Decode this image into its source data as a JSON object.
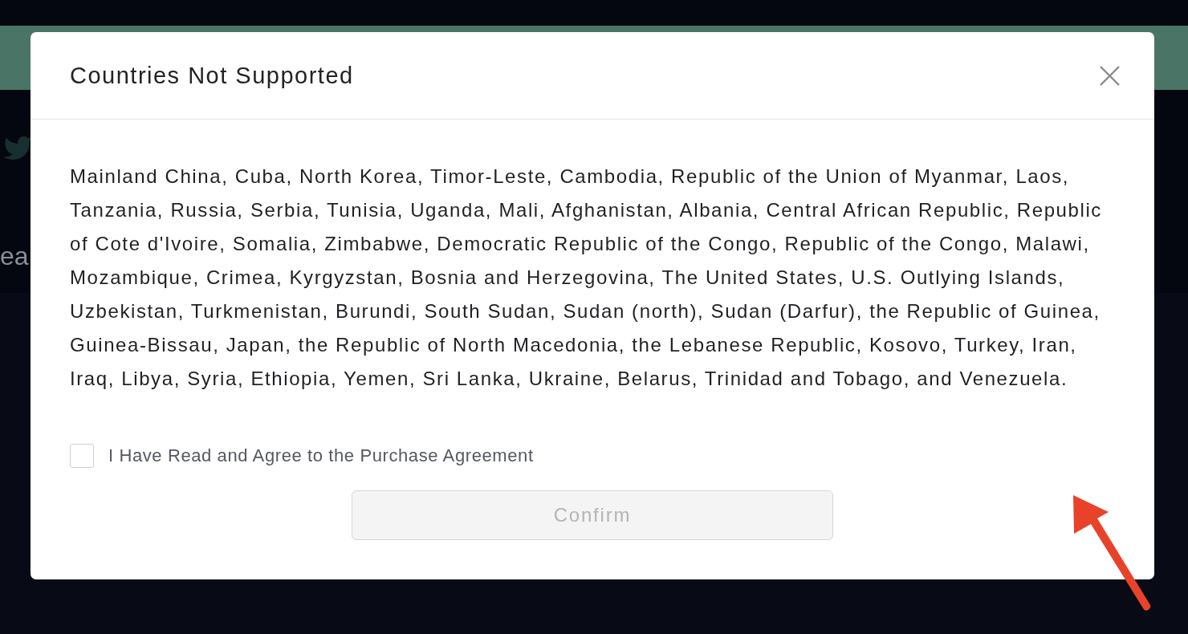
{
  "background": {
    "side_text": "ea"
  },
  "dialog": {
    "title": "Countries Not Supported",
    "message": "Mainland China, Cuba, North Korea, Timor-Leste, Cambodia, Republic of the Union of Myanmar, Laos, Tanzania, Russia, Serbia, Tunisia, Uganda, Mali, Afghanistan, Albania, Central African Republic, Republic of Cote d'Ivoire, Somalia, Zimbabwe, Democratic Republic of the Congo, Republic of the Congo, Malawi, Mozambique, Crimea, Kyrgyzstan, Bosnia and Herzegovina, The United States, U.S. Outlying Islands, Uzbekistan, Turkmenistan, Burundi, South Sudan, Sudan (north), Sudan (Darfur), the Republic of Guinea, Guinea-Bissau, Japan, the Republic of North Macedonia, the Lebanese Republic, Kosovo, Turkey, Iran, Iraq, Libya, Syria, Ethiopia, Yemen, Sri Lanka, Ukraine, Belarus, Trinidad and Tobago, and Venezuela.",
    "agreement": {
      "label": "I Have Read and Agree to the Purchase Agreement",
      "checked": false
    },
    "confirm_button": {
      "label": "Confirm",
      "disabled": true
    }
  }
}
